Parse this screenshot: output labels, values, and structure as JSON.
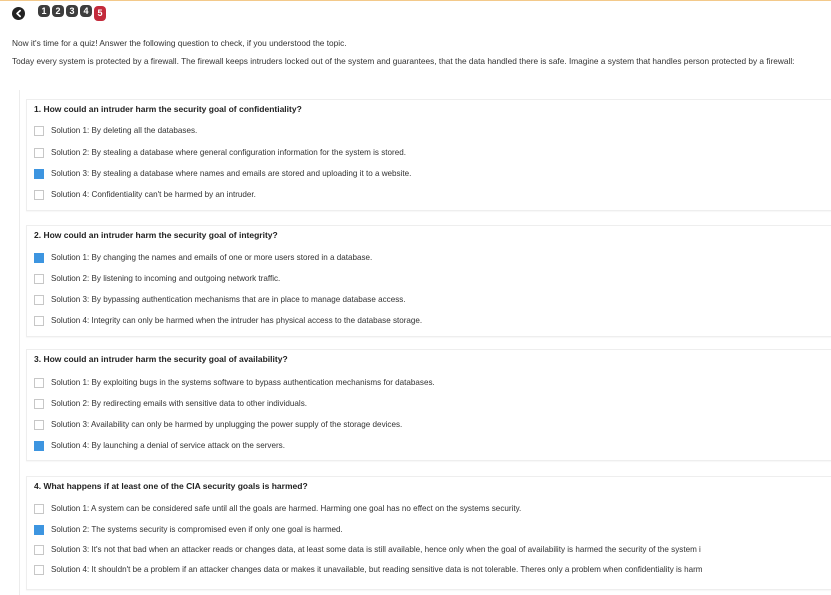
{
  "nav": {
    "back_icon": "back-arrow-icon",
    "steps": [
      "1",
      "2",
      "3",
      "4",
      "5"
    ],
    "active_step": "5"
  },
  "intro": "Now it's time for a quiz! Answer the following question to check, if you understood the topic.",
  "description": "Today every system is protected by a firewall. The firewall keeps intruders locked out of the system and guarantees, that the data handled there is safe. Imagine a system that handles person protected by a firewall:",
  "colors": {
    "checked": "#3d95e0",
    "active_step": "#c32a3b",
    "step": "#3d3d3d"
  },
  "questions": [
    {
      "title": "1. How could an intruder harm the security goal of confidentiality?",
      "options": [
        {
          "label": "Solution 1: By deleting all the databases.",
          "checked": false
        },
        {
          "label": "Solution 2: By stealing a database where general configuration information for the system is stored.",
          "checked": false
        },
        {
          "label": "Solution 3: By stealing a database where names and emails are stored and uploading it to a website.",
          "checked": true
        },
        {
          "label": "Solution 4: Confidentiality can't be harmed by an intruder.",
          "checked": false
        }
      ]
    },
    {
      "title": "2. How could an intruder harm the security goal of integrity?",
      "options": [
        {
          "label": "Solution 1: By changing the names and emails of one or more users stored in a database.",
          "checked": true
        },
        {
          "label": "Solution 2: By listening to incoming and outgoing network traffic.",
          "checked": false
        },
        {
          "label": "Solution 3: By bypassing authentication mechanisms that are in place to manage database access.",
          "checked": false
        },
        {
          "label": "Solution 4: Integrity can only be harmed when the intruder has physical access to the database storage.",
          "checked": false
        }
      ]
    },
    {
      "title": "3. How could an intruder harm the security goal of availability?",
      "options": [
        {
          "label": "Solution 1: By exploiting bugs in the systems software to bypass authentication mechanisms for databases.",
          "checked": false
        },
        {
          "label": "Solution 2: By redirecting emails with sensitive data to other individuals.",
          "checked": false
        },
        {
          "label": "Solution 3: Availability can only be harmed by unplugging the power supply of the storage devices.",
          "checked": false
        },
        {
          "label": "Solution 4: By launching a denial of service attack on the servers.",
          "checked": true
        }
      ]
    },
    {
      "title": "4. What happens if at least one of the CIA security goals is harmed?",
      "options": [
        {
          "label": "Solution 1: A system can be considered safe until all the goals are harmed. Harming one goal has no effect on the systems security.",
          "checked": false
        },
        {
          "label": "Solution 2: The systems security is compromised even if only one goal is harmed.",
          "checked": true
        },
        {
          "label": "Solution 3: It's not that bad when an attacker reads or changes data, at least some data is still available, hence only when the goal of availability is harmed the security of the system i",
          "checked": false
        },
        {
          "label": "Solution 4: It shouldn't be a problem if an attacker changes data or makes it unavailable, but reading sensitive data is not tolerable. Theres only a problem when confidentiality is harm",
          "checked": false
        }
      ]
    }
  ]
}
